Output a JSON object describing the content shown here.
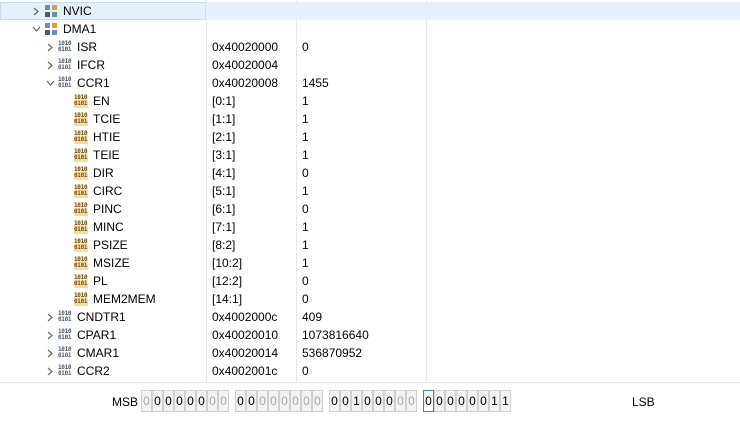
{
  "columns": {
    "name": "",
    "address": "",
    "value": ""
  },
  "rows": [
    {
      "name": "NVIC",
      "address": "",
      "value": "",
      "level": 1,
      "kind": "peripheral",
      "expand": "collapsed"
    },
    {
      "name": "DMA1",
      "address": "",
      "value": "",
      "level": 1,
      "kind": "peripheral",
      "expand": "expanded"
    },
    {
      "name": "ISR",
      "address": "0x40020000",
      "value": "0",
      "level": 2,
      "kind": "register",
      "expand": "collapsed"
    },
    {
      "name": "IFCR",
      "address": "0x40020004",
      "value": "",
      "level": 2,
      "kind": "register",
      "expand": "collapsed"
    },
    {
      "name": "CCR1",
      "address": "0x40020008",
      "value": "1455",
      "level": 2,
      "kind": "register",
      "expand": "expanded"
    },
    {
      "name": "EN",
      "address": "[0:1]",
      "value": "1",
      "level": 3,
      "kind": "field",
      "expand": "none"
    },
    {
      "name": "TCIE",
      "address": "[1:1]",
      "value": "1",
      "level": 3,
      "kind": "field",
      "expand": "none"
    },
    {
      "name": "HTIE",
      "address": "[2:1]",
      "value": "1",
      "level": 3,
      "kind": "field",
      "expand": "none"
    },
    {
      "name": "TEIE",
      "address": "[3:1]",
      "value": "1",
      "level": 3,
      "kind": "field",
      "expand": "none"
    },
    {
      "name": "DIR",
      "address": "[4:1]",
      "value": "0",
      "level": 3,
      "kind": "field",
      "expand": "none"
    },
    {
      "name": "CIRC",
      "address": "[5:1]",
      "value": "1",
      "level": 3,
      "kind": "field",
      "expand": "none"
    },
    {
      "name": "PINC",
      "address": "[6:1]",
      "value": "0",
      "level": 3,
      "kind": "field",
      "expand": "none"
    },
    {
      "name": "MINC",
      "address": "[7:1]",
      "value": "1",
      "level": 3,
      "kind": "field",
      "expand": "none"
    },
    {
      "name": "PSIZE",
      "address": "[8:2]",
      "value": "1",
      "level": 3,
      "kind": "field",
      "expand": "none"
    },
    {
      "name": "MSIZE",
      "address": "[10:2]",
      "value": "1",
      "level": 3,
      "kind": "field",
      "expand": "none"
    },
    {
      "name": "PL",
      "address": "[12:2]",
      "value": "0",
      "level": 3,
      "kind": "field",
      "expand": "none"
    },
    {
      "name": "MEM2MEM",
      "address": "[14:1]",
      "value": "0",
      "level": 3,
      "kind": "field",
      "expand": "none"
    },
    {
      "name": "CNDTR1",
      "address": "0x4002000c",
      "value": "409",
      "level": 2,
      "kind": "register",
      "expand": "collapsed"
    },
    {
      "name": "CPAR1",
      "address": "0x40020010",
      "value": "1073816640",
      "level": 2,
      "kind": "register",
      "expand": "collapsed"
    },
    {
      "name": "CMAR1",
      "address": "0x40020014",
      "value": "536870952",
      "level": 2,
      "kind": "register",
      "expand": "collapsed"
    },
    {
      "name": "CCR2",
      "address": "0x4002001c",
      "value": "0",
      "level": 2,
      "kind": "register",
      "expand": "collapsed"
    }
  ],
  "selected_row": "NVIC",
  "icon_text": {
    "line1": "1010",
    "line2": "0101"
  },
  "bit_view": {
    "msb_label": "MSB",
    "lsb_label": "LSB",
    "bits": [
      "0",
      "0",
      "0",
      "0",
      "0",
      "0",
      "0",
      "0",
      "0",
      "0",
      "0",
      "0",
      "0",
      "0",
      "0",
      "0",
      "0",
      "0",
      "1",
      "0",
      "0",
      "0",
      "0",
      "0",
      "0",
      "0",
      "0",
      "0",
      "0",
      "0",
      "1",
      "1"
    ],
    "dimmed_indices": [
      0,
      6,
      7,
      10,
      11,
      12,
      13,
      14,
      15,
      22,
      23
    ],
    "focused_index": 24
  },
  "colors": {
    "selection": "#e6f0fa",
    "grid_line": "#e8e8e8",
    "bit_focus": "#3f7fd1",
    "field_icon": "#f3dd92"
  }
}
